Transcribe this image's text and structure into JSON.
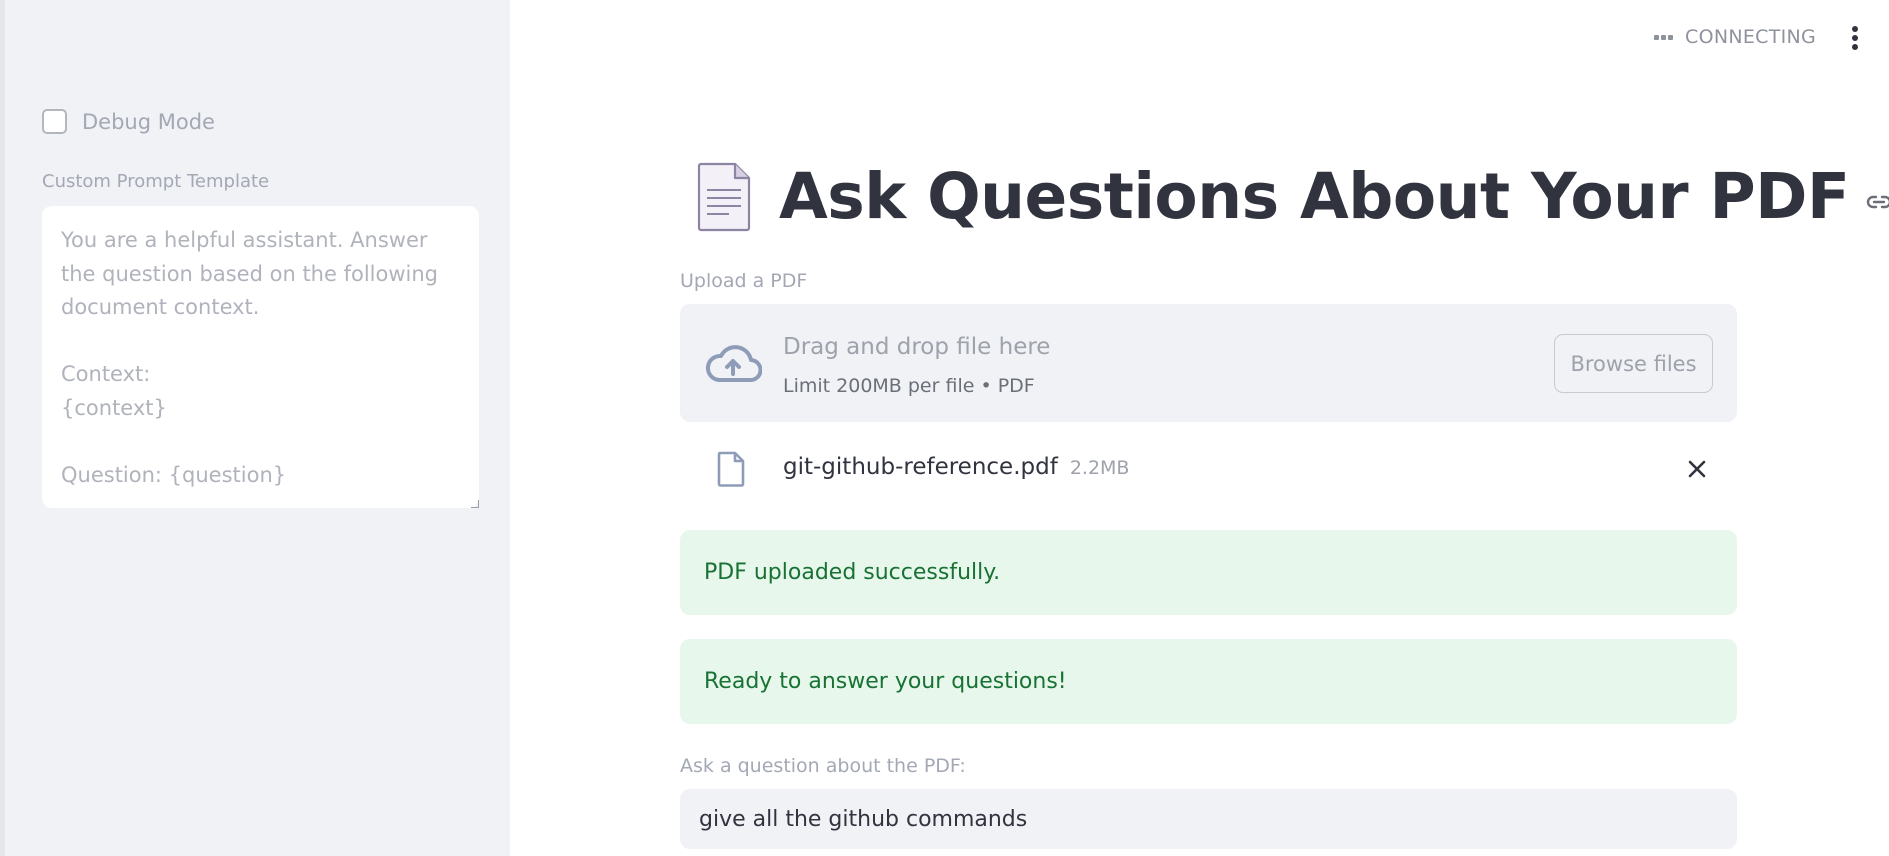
{
  "sidebar": {
    "debug_label": "Debug Mode",
    "prompt_label": "Custom Prompt Template",
    "prompt_value": "You are a helpful assistant. Answer the question based on the following document context.\n\nContext:\n{context}\n\nQuestion: {question}"
  },
  "header": {
    "status": "CONNECTING"
  },
  "main": {
    "title": "Ask Questions About Your PDF",
    "upload_label": "Upload a PDF",
    "dropzone": {
      "main_text": "Drag and drop file here",
      "sub_text": "Limit 200MB per file • PDF",
      "browse_label": "Browse files"
    },
    "file": {
      "name": "git-github-reference.pdf",
      "size": "2.2MB"
    },
    "alerts": [
      "PDF uploaded successfully.",
      "Ready to answer your questions!"
    ],
    "question_label": "Ask a question about the PDF:",
    "question_value": "give all the github commands"
  },
  "colors": {
    "sidebar_bg": "#f0f2f6",
    "success_bg": "#e7f7ec",
    "success_text": "#177233",
    "text": "#31333f",
    "muted": "#a3a8b4"
  }
}
